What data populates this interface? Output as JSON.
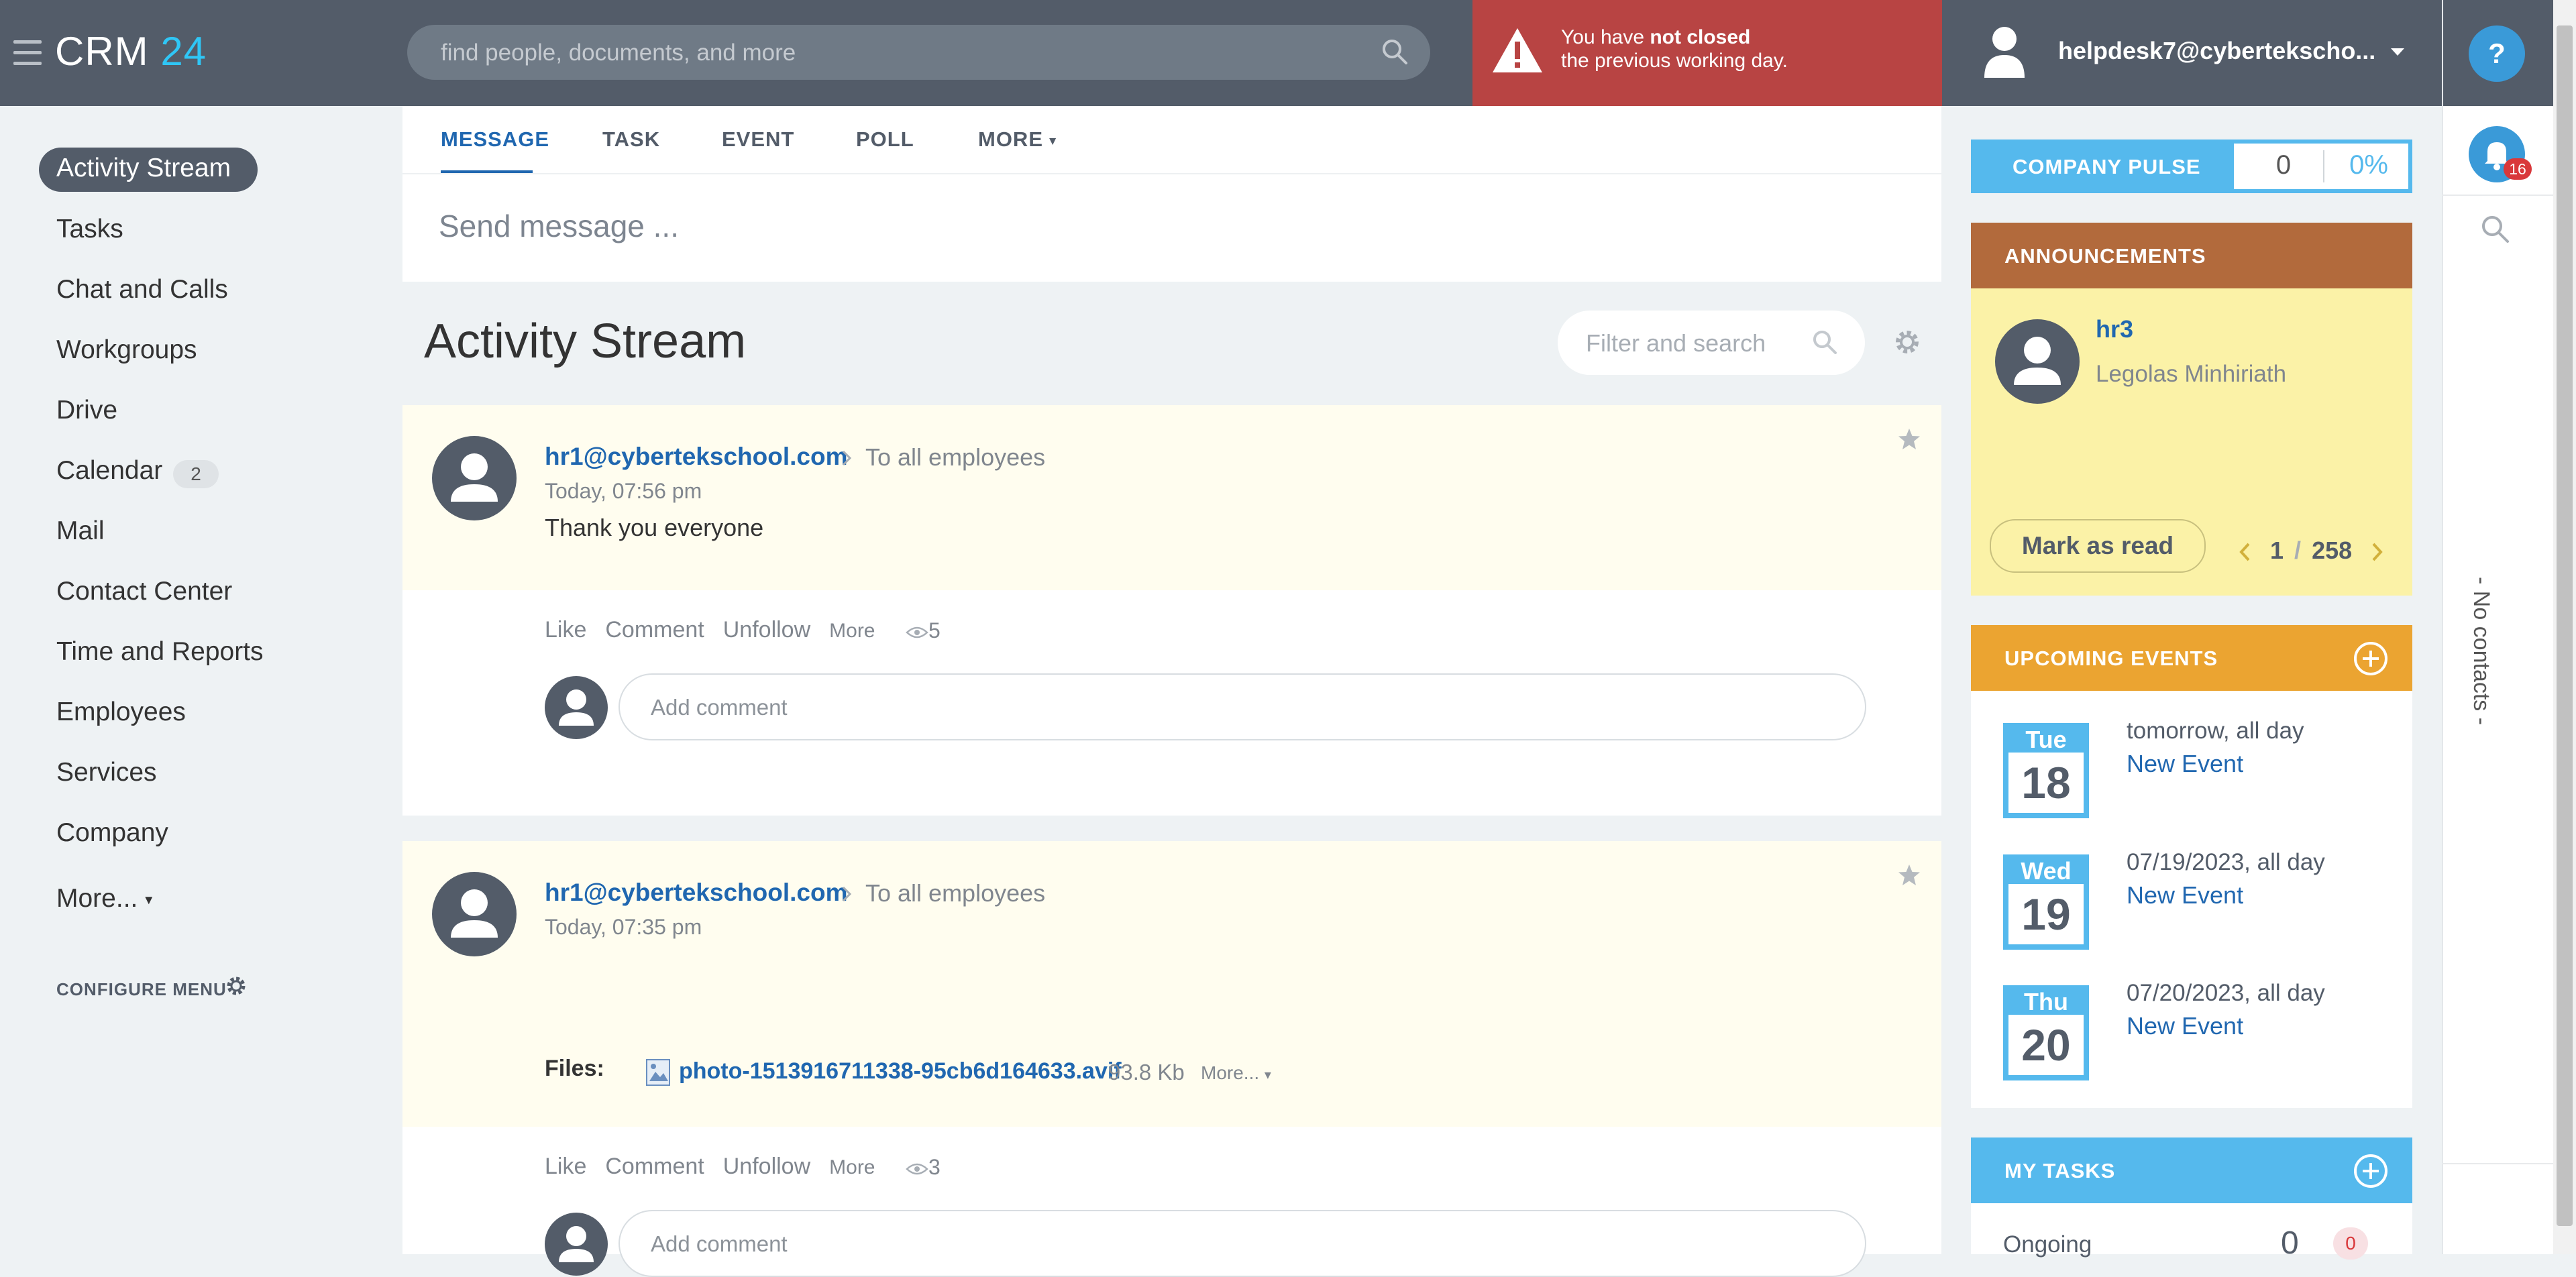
{
  "header": {
    "logo_main": "CRM",
    "logo_num": "24",
    "search_placeholder": "find people, documents, and more",
    "warning_pre": "You have ",
    "warning_bold": "not closed",
    "warning_line2": "the previous working day.",
    "user_name": "helpdesk7@cybertekscho...",
    "help_label": "?",
    "notification_count": "16"
  },
  "sidebar": {
    "items": [
      {
        "label": "Activity Stream"
      },
      {
        "label": "Tasks"
      },
      {
        "label": "Chat and Calls"
      },
      {
        "label": "Workgroups"
      },
      {
        "label": "Drive"
      },
      {
        "label": "Calendar"
      },
      {
        "label": "Mail"
      },
      {
        "label": "Contact Center"
      },
      {
        "label": "Time and Reports"
      },
      {
        "label": "Employees"
      },
      {
        "label": "Services"
      },
      {
        "label": "Company"
      },
      {
        "label": "More..."
      }
    ],
    "calendar_badge": "2",
    "configure_label": "CONFIGURE MENU"
  },
  "composer": {
    "tabs": [
      "MESSAGE",
      "TASK",
      "EVENT",
      "POLL",
      "MORE"
    ],
    "placeholder": "Send message ..."
  },
  "stream": {
    "title": "Activity Stream",
    "filter_placeholder": "Filter and search",
    "posts": [
      {
        "author": "hr1@cybertekschool.com",
        "destination": "To all employees",
        "time": "Today, 07:56 pm",
        "text": "Thank you everyone",
        "actions": [
          "Like",
          "Comment",
          "Unfollow",
          "More"
        ],
        "views": "5",
        "comment_placeholder": "Add comment"
      },
      {
        "author": "hr1@cybertekschool.com",
        "destination": "To all employees",
        "time": "Today, 07:35 pm",
        "files_label": "Files:",
        "file_name": "photo-1513916711338-95cb6d164633.avif",
        "file_size": "93.8 Kb",
        "file_more": "More...",
        "actions": [
          "Like",
          "Comment",
          "Unfollow",
          "More"
        ],
        "views": "3",
        "comment_placeholder": "Add comment"
      }
    ]
  },
  "right": {
    "pulse_label": "COMPANY PULSE",
    "pulse_count": "0",
    "pulse_percent": "0%",
    "announcements": {
      "title": "ANNOUNCEMENTS",
      "author": "hr3",
      "text": "Legolas Minhiriath",
      "mark_read": "Mark as read",
      "page_current": "1",
      "page_sep": "/",
      "page_total": "258"
    },
    "events": {
      "title": "UPCOMING EVENTS",
      "items": [
        {
          "day": "Tue",
          "date": "18",
          "when": "tomorrow, all day",
          "name": "New Event"
        },
        {
          "day": "Wed",
          "date": "19",
          "when": "07/19/2023, all day",
          "name": "New Event"
        },
        {
          "day": "Thu",
          "date": "20",
          "when": "07/20/2023, all day",
          "name": "New Event"
        }
      ]
    },
    "tasks": {
      "title": "MY TASKS",
      "ongoing_label": "Ongoing",
      "ongoing_count": "0",
      "ongoing_badge": "0"
    }
  },
  "rail": {
    "no_contacts": "- No contacts -"
  },
  "colors": {
    "header_bg": "#535c69",
    "warning_bg": "#b84443",
    "link": "#2067b0",
    "pulse_blue": "#55b9ed",
    "announcement_brown": "#b26a3c",
    "events_orange": "#eba431",
    "post_bg": "#fffdef",
    "announcement_bg": "#fbf2a7"
  }
}
